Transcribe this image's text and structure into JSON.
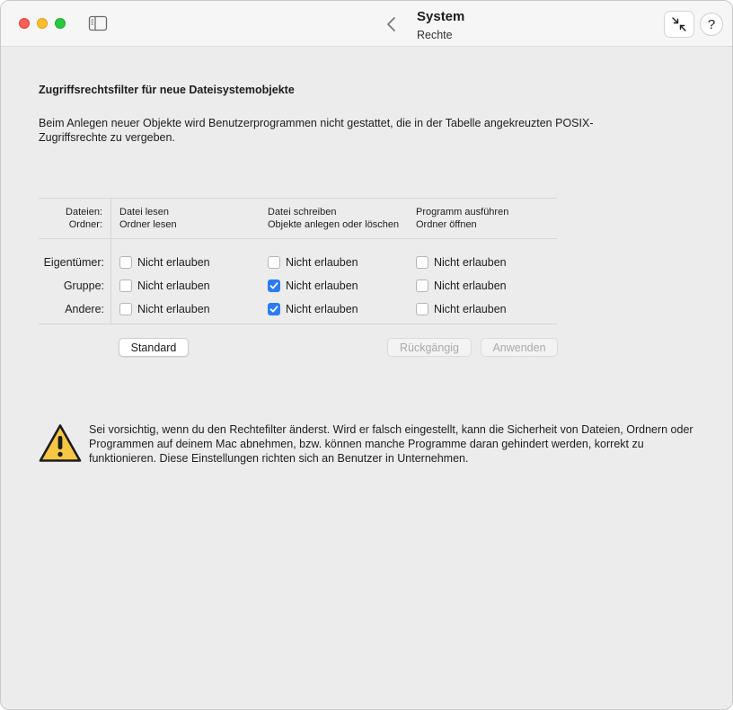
{
  "window": {
    "title": "System",
    "subtitle": "Rechte"
  },
  "toolbar": {
    "help_label": "?"
  },
  "content": {
    "heading": "Zugriffsrechtsfilter für neue Dateisystemobjekte",
    "description": "Beim Anlegen neuer Objekte wird Benutzerprogrammen nicht gestattet, die in der Tabelle angekreuzten POSIX-Zugriffsrechte zu vergeben."
  },
  "table": {
    "row_header": {
      "files": "Dateien:",
      "folders": "Ordner:"
    },
    "columns": [
      {
        "files": "Datei lesen",
        "folders": "Ordner lesen"
      },
      {
        "files": "Datei schreiben",
        "folders": "Objekte anlegen oder löschen"
      },
      {
        "files": "Programm ausführen",
        "folders": "Ordner öffnen"
      }
    ],
    "rows": [
      {
        "label": "Eigentümer:",
        "cells": [
          {
            "label": "Nicht erlauben",
            "checked": false
          },
          {
            "label": "Nicht erlauben",
            "checked": false
          },
          {
            "label": "Nicht erlauben",
            "checked": false
          }
        ]
      },
      {
        "label": "Gruppe:",
        "cells": [
          {
            "label": "Nicht erlauben",
            "checked": false
          },
          {
            "label": "Nicht erlauben",
            "checked": true
          },
          {
            "label": "Nicht erlauben",
            "checked": false
          }
        ]
      },
      {
        "label": "Andere:",
        "cells": [
          {
            "label": "Nicht erlauben",
            "checked": false
          },
          {
            "label": "Nicht erlauben",
            "checked": true
          },
          {
            "label": "Nicht erlauben",
            "checked": false
          }
        ]
      }
    ]
  },
  "buttons": {
    "standard": "Standard",
    "undo": "Rückgängig",
    "apply": "Anwenden"
  },
  "warning": {
    "text": "Sei vorsichtig, wenn du den Rechtefilter änderst. Wird er falsch eingestellt, kann die Sicherheit von Dateien, Ordnern oder Programmen auf deinem Mac abnehmen, bzw. können manche Programme daran gehindert werden, korrekt zu funktionieren. Diese Einstellungen richten sich an Benutzer in Unternehmen."
  },
  "colors": {
    "accent": "#2a7cf6",
    "warning_fill": "#f7c744"
  }
}
